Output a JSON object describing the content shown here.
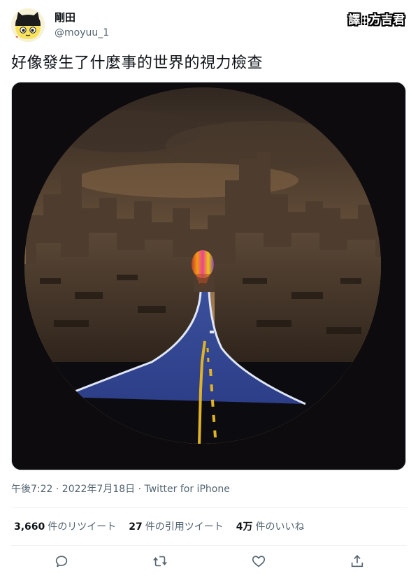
{
  "tweet": {
    "author_name": "剛田",
    "author_handle": "@moyuu_1",
    "text": "好像發生了什麼事的世界的視力檢查",
    "timestamp": "午後7:22 · 2022年7月18日 · Twitter for iPhone"
  },
  "credit": {
    "label": "譯",
    "separator": ":",
    "translator": "方吉君"
  },
  "stats": [
    {
      "count": "3,660",
      "label": "件のリツイート"
    },
    {
      "count": "27",
      "label": "件の引用ツイート"
    },
    {
      "count": "4万",
      "label": "件のいいね"
    }
  ],
  "actions": {
    "reply_icon": "reply-icon",
    "retweet_icon": "retweet-icon",
    "like_icon": "heart-icon",
    "share_icon": "share-icon"
  },
  "colors": {
    "text_primary": "#0f1419",
    "text_secondary": "#536471",
    "divider": "#eff3f4",
    "icon": "#536471"
  }
}
